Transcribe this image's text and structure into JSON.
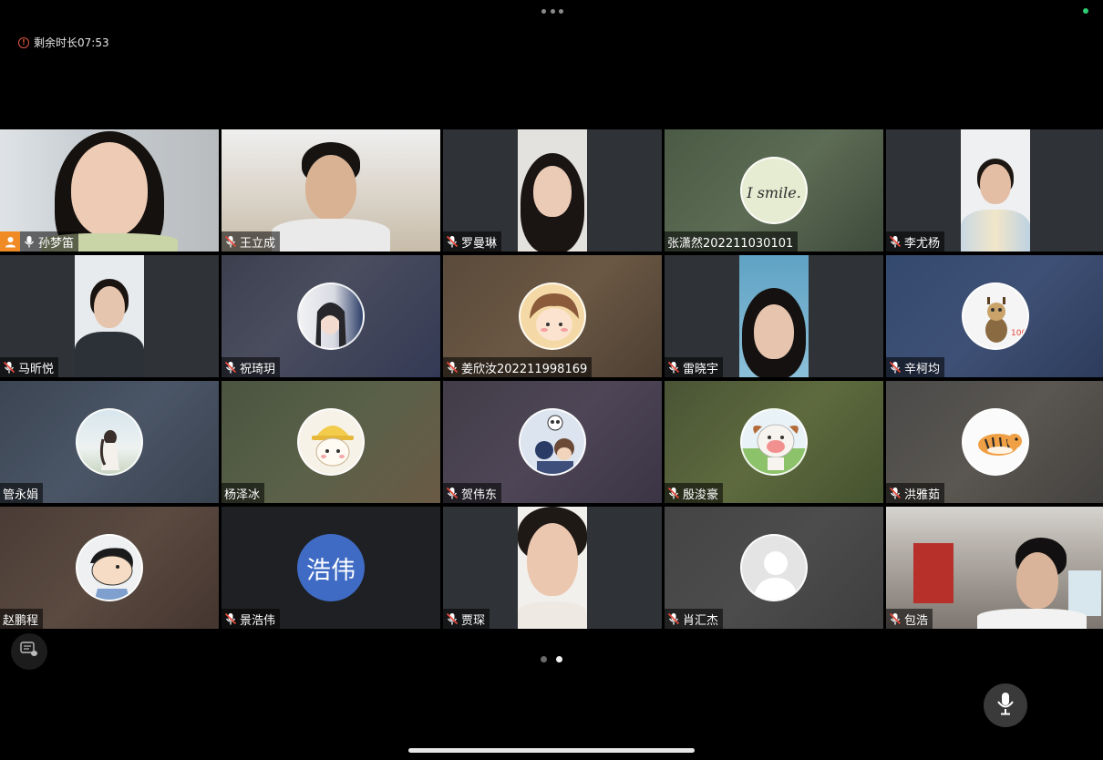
{
  "top": {
    "more_icon": "ellipsis-icon",
    "status_color": "#2ecc71"
  },
  "timer": {
    "text": "剩余时长07:53",
    "icon": "info-circle-icon",
    "color": "#e0563f"
  },
  "participants": [
    {
      "name": "孙梦笛",
      "mic": "on",
      "host": true
    },
    {
      "name": "王立成",
      "mic": "muted"
    },
    {
      "name": "罗曼琳",
      "mic": "muted"
    },
    {
      "name": "张潇然202211030101",
      "mic": "none",
      "avatar_text": "I smile."
    },
    {
      "name": "李尤杨",
      "mic": "muted"
    },
    {
      "name": "马昕悦",
      "mic": "muted"
    },
    {
      "name": "祝琦玥",
      "mic": "muted"
    },
    {
      "name": "姜欣汝202211998169",
      "mic": "muted"
    },
    {
      "name": "雷晓宇",
      "mic": "muted"
    },
    {
      "name": "辛柯均",
      "mic": "muted"
    },
    {
      "name": "管永娟",
      "mic": "none"
    },
    {
      "name": "杨泽冰",
      "mic": "none"
    },
    {
      "name": "贺伟东",
      "mic": "muted"
    },
    {
      "name": "殷浚豪",
      "mic": "muted"
    },
    {
      "name": "洪雅茹",
      "mic": "muted"
    },
    {
      "name": "赵鹏程",
      "mic": "none"
    },
    {
      "name": "景浩伟",
      "mic": "muted",
      "avatar_text": "浩伟"
    },
    {
      "name": "贾琛",
      "mic": "muted"
    },
    {
      "name": "肖汇杰",
      "mic": "muted"
    },
    {
      "name": "包浩",
      "mic": "muted"
    }
  ],
  "pagination": {
    "total": 2,
    "current": 2
  },
  "controls": {
    "chat_icon": "chat-bubble-icon",
    "mic_icon": "microphone-icon"
  }
}
